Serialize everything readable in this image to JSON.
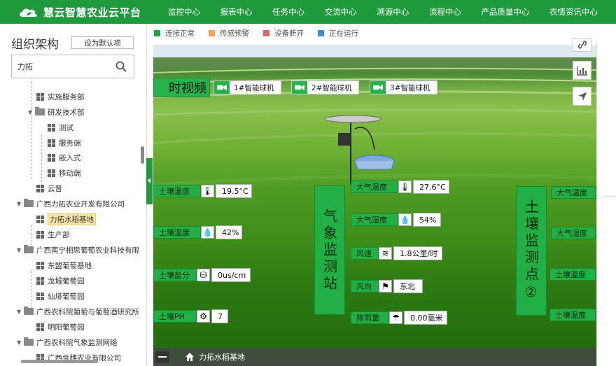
{
  "app": {
    "title": "慧云智慧农业云平台"
  },
  "nav": [
    "监控中心",
    "报表中心",
    "任务中心",
    "交流中心",
    "溯源中心",
    "流程中心",
    "产品质量中心",
    "农情资讯中心"
  ],
  "sidebar": {
    "title": "组织架构",
    "default_btn": "设为默认项",
    "search_value": "力拓",
    "tree": [
      {
        "label": "实施服务部",
        "type": "leaf"
      },
      {
        "label": "研发技术部",
        "type": "folder"
      },
      {
        "label": "测试",
        "type": "leaf"
      },
      {
        "label": "服务端",
        "type": "leaf"
      },
      {
        "label": "嵌入式",
        "type": "leaf"
      },
      {
        "label": "移动端",
        "type": "leaf"
      },
      {
        "label": "云晋",
        "type": "leaf"
      },
      {
        "label": "广西力拓农业开发有限公司",
        "type": "folder"
      },
      {
        "label": "力拓水稻基地",
        "type": "leaf"
      },
      {
        "label": "生产部",
        "type": "leaf"
      },
      {
        "label": "广西南宁相思葡萄农业科技有限",
        "type": "folder"
      },
      {
        "label": "东盟葡萄基地",
        "type": "leaf"
      },
      {
        "label": "龙城葡萄园",
        "type": "leaf"
      },
      {
        "label": "仙境葡萄园",
        "type": "leaf"
      },
      {
        "label": "广西农科院葡萄与葡萄酒研究所",
        "type": "folder"
      },
      {
        "label": "明阳葡萄园",
        "type": "leaf"
      },
      {
        "label": "广西农科院气象监测网络",
        "type": "folder"
      },
      {
        "label": "广西金穗农业有限公司",
        "type": "leaf"
      }
    ]
  },
  "legend": [
    {
      "label": "连接正常",
      "color": "#2e9e44"
    },
    {
      "label": "传感预警",
      "color": "#f0a35e"
    },
    {
      "label": "设备断开",
      "color": "#e06666"
    },
    {
      "label": "正在运行",
      "color": "#3f8fd6"
    }
  ],
  "scene": {
    "video_title": "时视频",
    "cameras": [
      "1#智能球机",
      "2#智能球机",
      "3#智能球机"
    ],
    "soil_left": [
      {
        "label": "土壤温度",
        "icon": "thermo-soil-icon",
        "value": "19.5°C"
      },
      {
        "label": "土壤湿度",
        "icon": "humidity-soil-icon",
        "value": "42%"
      },
      {
        "label": "土壤盐分",
        "icon": "salinity-icon",
        "value": "0us/cm"
      },
      {
        "label": "土壤PH",
        "icon": "ph-icon",
        "value": "7"
      }
    ],
    "weather_station": "气象监测站",
    "weather": [
      {
        "label": "大气温度",
        "icon": "thermometer-icon",
        "value": "27.6°C"
      },
      {
        "label": "大气湿度",
        "icon": "water-drop-icon",
        "value": "54%"
      },
      {
        "label": "风速",
        "icon": "wind-speed-icon",
        "value": "1.8公里/时"
      },
      {
        "label": "风向",
        "icon": "wind-direction-icon",
        "value": "东北"
      },
      {
        "label": "降雨量",
        "icon": "rain-icon",
        "value": "0.00毫米"
      }
    ],
    "soil_station": "土壤监测点②",
    "soil_right": [
      "大气温度",
      "大气湿度",
      "土壤温度",
      "土壤温度"
    ],
    "breadcrumb": "力拓水稻基地"
  }
}
